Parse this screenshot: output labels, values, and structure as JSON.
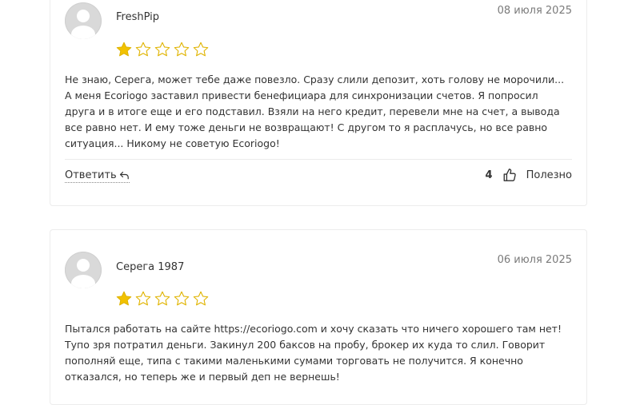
{
  "colors": {
    "star_filled": "#f2c200",
    "star_outline": "#e0b400",
    "card_border": "#ececec",
    "date_text": "#7a7a7a"
  },
  "reviews": [
    {
      "author": "FreshPip",
      "date": "08 июля 2025",
      "rating": 1,
      "max_rating": 5,
      "lines": [
        "Не знаю, Серега, может тебе даже повезло. Сразу слили депозит, хоть голову не морочили...",
        "А меня Ecoriogo заставил привести бенефициара для синхронизации счетов. Я попросил",
        "друга и в итоге еще и его подставил. Взяли на него кредит, перевели мне на счет, а вывода",
        "все равно нет. И ему тоже деньги не возвращают! С другом то я расплачусь, но все равно",
        "ситуация... Никому не советую Ecoriogo!"
      ],
      "reply_label": "Ответить",
      "reply_icon": "reply-arrow-icon",
      "like_count": "4",
      "like_icon": "thumbs-up-icon",
      "useful_label": "Полезно"
    },
    {
      "author": "Серега 1987",
      "date": "06 июля 2025",
      "rating": 1,
      "max_rating": 5,
      "lines": [
        "Пытался работать на сайте https://ecoriogo.com и хочу сказать что ничего хорошего там нет!",
        "Тупо зря потратил деньги. Закинул 200 баксов на пробу, брокер их куда то слил. Говорит",
        "пополняй еще, типа с такими маленькими сумами торговать не получится. Я конечно",
        "отказался, но теперь же и первый деп не вернешь!"
      ]
    }
  ]
}
